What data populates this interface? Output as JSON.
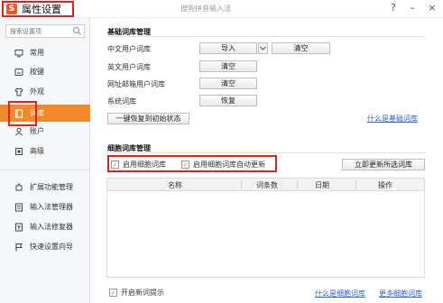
{
  "window": {
    "title": "属性设置",
    "app_name": "搜狗拼音输入法",
    "help": "?",
    "minimize": "–",
    "close": "×"
  },
  "sidebar": {
    "search_placeholder": "搜索设置项",
    "items": [
      {
        "label": "常用",
        "icon": "monitor-icon"
      },
      {
        "label": "按键",
        "icon": "keyboard-icon"
      },
      {
        "label": "外观",
        "icon": "shirt-icon"
      },
      {
        "label": "词库",
        "icon": "book-icon",
        "active": true
      },
      {
        "label": "账户",
        "icon": "user-icon"
      },
      {
        "label": "高级",
        "icon": "box-icon"
      },
      {
        "label": "扩展功能管理",
        "icon": "puzzle-icon"
      },
      {
        "label": "输入法管理器",
        "icon": "list-icon"
      },
      {
        "label": "输入法修复器",
        "icon": "wrench-icon"
      },
      {
        "label": "快速设置向导",
        "icon": "flag-icon"
      }
    ]
  },
  "basic": {
    "section_title": "基础词库管理",
    "rows": [
      {
        "label": "中文用户词库",
        "primary": "导入",
        "secondary": "清空"
      },
      {
        "label": "英文用户词库",
        "primary": "清空"
      },
      {
        "label": "网址邮箱用户词库",
        "primary": "清空"
      },
      {
        "label": "系统词库",
        "primary": "恢复"
      }
    ],
    "reset_button": "一键恢复到初始状态",
    "help_link": "什么是基础词库"
  },
  "cell": {
    "section_title": "细胞词库管理",
    "enable_label": "启用细胞词库",
    "auto_update_label": "启用细胞词库自动更新",
    "update_button": "立即更新所选词库",
    "columns": [
      "名称",
      "词条数",
      "日期",
      "操作"
    ]
  },
  "footer": {
    "new_word_tip": "开启新词提示",
    "what_is_cell_link": "什么是细胞词库",
    "more_link": "更多细胞词库"
  },
  "colors": {
    "accent": "#f28a2c",
    "highlight_border": "#e02020",
    "link": "#2a64c7"
  }
}
